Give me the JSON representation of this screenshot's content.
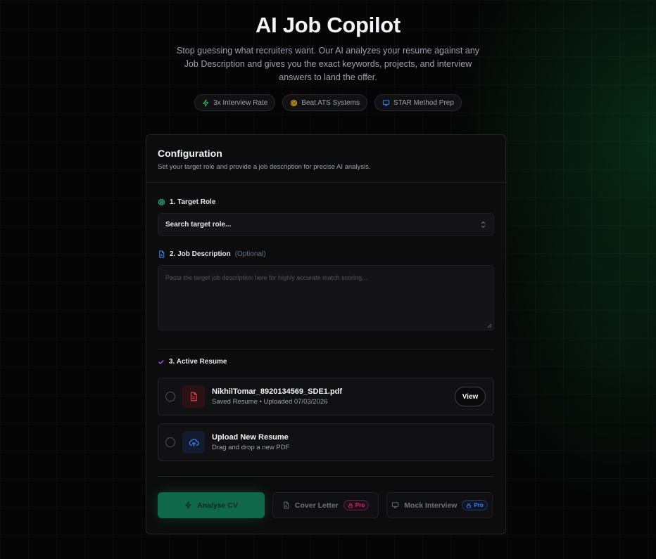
{
  "hero": {
    "title": "AI Job Copilot",
    "subtitle": "Stop guessing what recruiters want. Our AI analyzes your resume against any Job Description and gives you the exact keywords, projects, and interview answers to land the offer.",
    "pills": [
      {
        "label": "3x Interview Rate",
        "icon": "zap-icon",
        "color": "#22c55e"
      },
      {
        "label": "Beat ATS Systems",
        "icon": "target-icon",
        "color": "#eab308"
      },
      {
        "label": "STAR Method Prep",
        "icon": "monitor-icon",
        "color": "#3b82f6"
      }
    ]
  },
  "config": {
    "title": "Configuration",
    "description": "Set your target role and provide a job description for precise AI analysis.",
    "target_role": {
      "label": "1. Target Role",
      "value": "Search target role..."
    },
    "job_description": {
      "label": "2. Job Description",
      "optional": "(Optional)",
      "placeholder": "Paste the target job description here for highly accurate match scoring..."
    },
    "active_resume": {
      "label": "3. Active Resume",
      "saved": {
        "filename": "NikhilTomar_8920134569_SDE1.pdf",
        "meta": "Saved Resume • Uploaded 07/03/2026",
        "view_label": "View"
      },
      "upload": {
        "title": "Upload New Resume",
        "subtitle": "Drag and drop a new PDF"
      }
    }
  },
  "actions": {
    "analyse": "Analyse CV",
    "cover_letter": "Cover Letter",
    "mock_interview": "Mock Interview",
    "pro_badge": "Pro"
  },
  "colors": {
    "accent": "#10b981",
    "primary_button": "#10684a",
    "pdf_red": "#ef4444",
    "upload_blue": "#3b82f6"
  }
}
